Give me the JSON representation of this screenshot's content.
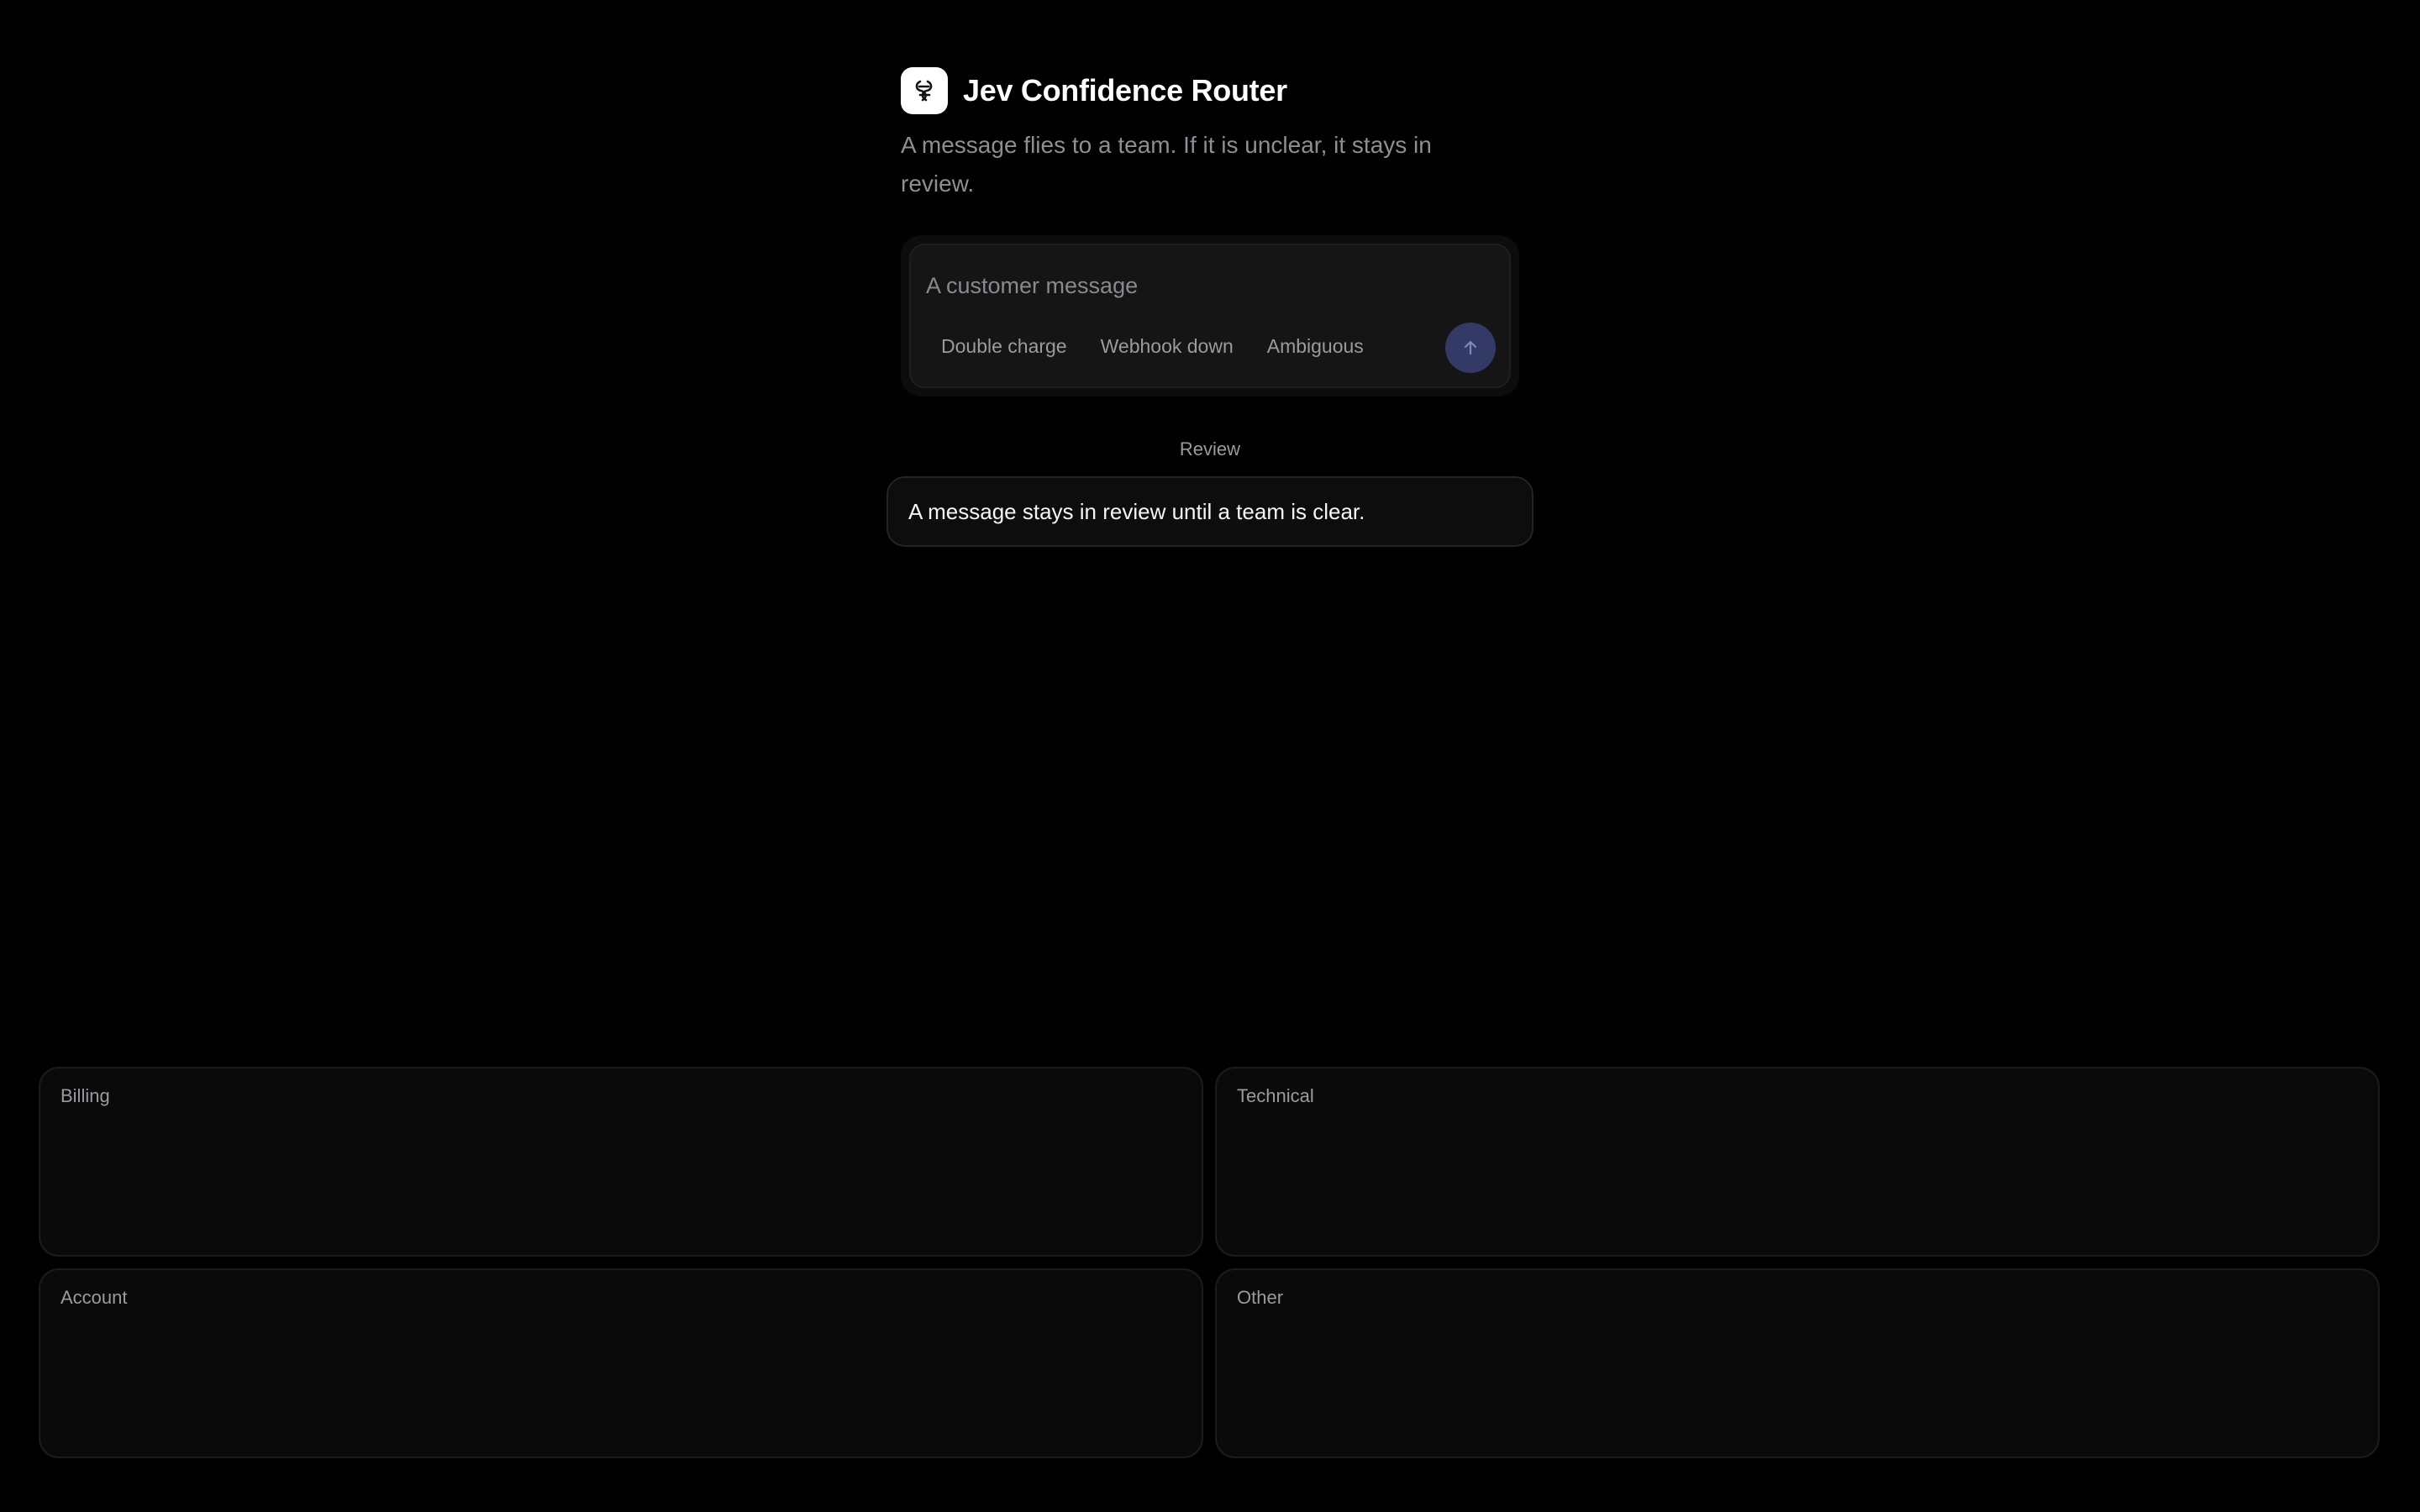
{
  "app": {
    "title": "Jev Confidence Router",
    "subtitle": "A message flies to a team. If it is unclear, it stays in review.",
    "logo_icon": "knot-icon"
  },
  "composer": {
    "placeholder": "A customer message",
    "value": "",
    "chips": [
      "Double charge",
      "Webhook down",
      "Ambiguous"
    ],
    "send_icon": "arrow-up-icon",
    "send_color": "#343a66"
  },
  "review": {
    "label": "Review",
    "message": "A message stays in review until a team is clear."
  },
  "teams": [
    {
      "label": "Billing"
    },
    {
      "label": "Technical"
    },
    {
      "label": "Account"
    },
    {
      "label": "Other"
    }
  ]
}
